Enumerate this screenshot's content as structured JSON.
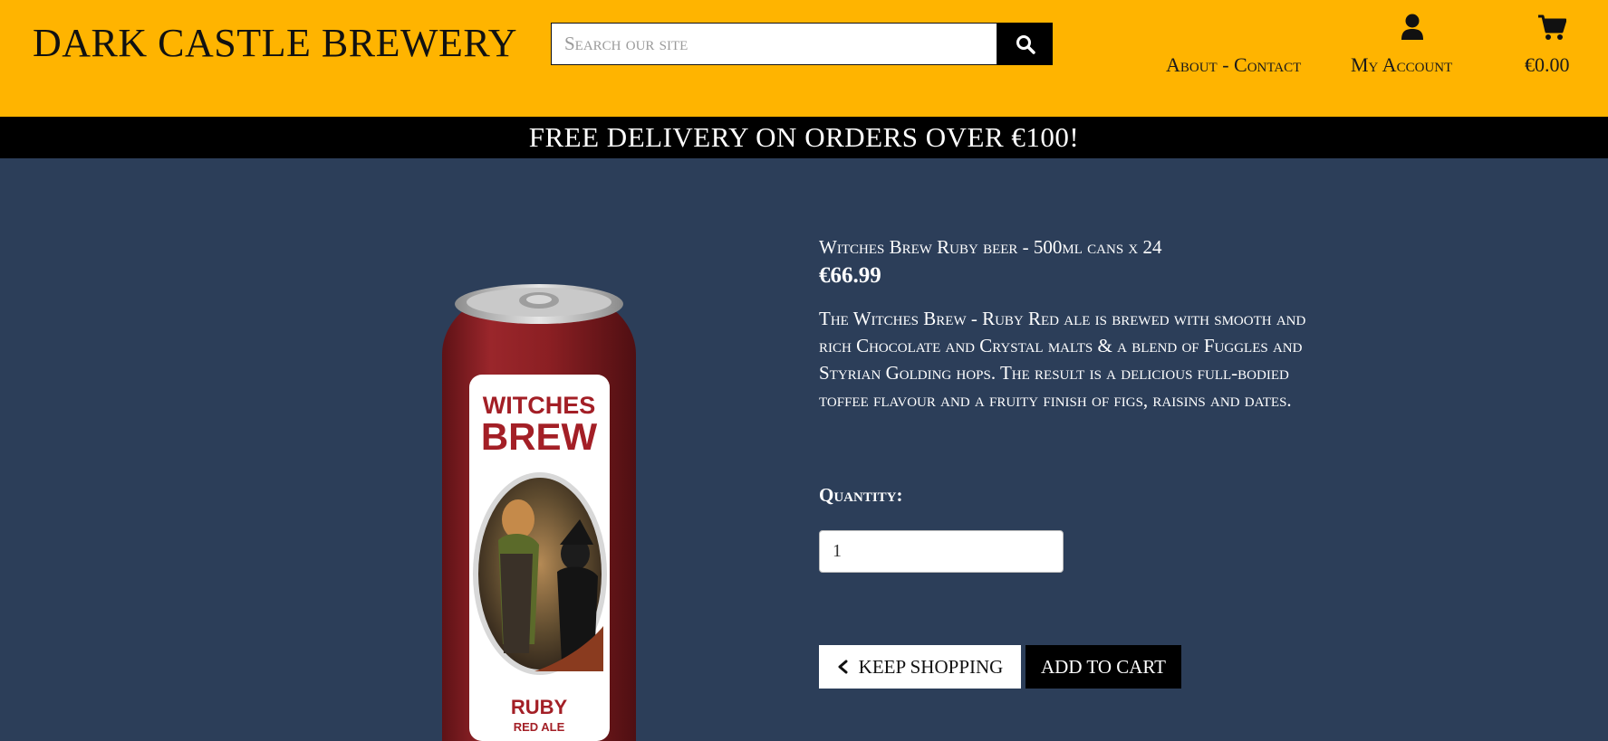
{
  "header": {
    "brand": "Dark Castle Brewery",
    "search": {
      "placeholder": "Search our site",
      "button_icon": "search-icon"
    },
    "nav": {
      "about_contact": "About - Contact",
      "my_account": "My Account",
      "my_account_icon": "user-icon",
      "cart_total": "€0.00",
      "cart_icon": "shopping-cart-icon"
    }
  },
  "banner": {
    "text": "Free delivery on orders over €100!"
  },
  "product": {
    "name": "Witches Brew Ruby beer - 500ml cans x 24",
    "price": "€66.99",
    "description": "The Witches Brew - Ruby Red ale is brewed with smooth and rich Chocolate and Crystal malts & a blend of Fuggles and Styrian Golding hops. The result is a delicious full-bodied toffee flavour and a fruity finish of figs, raisins and dates.",
    "image": {
      "label_line1": "WITCHES",
      "label_line2": "BREW",
      "label_line3": "RUBY",
      "label_line4": "RED ALE"
    },
    "quantity_label": "Quantity:",
    "quantity_value": "1",
    "keep_shopping": "Keep Shopping",
    "add_to_cart": "Add to Cart"
  },
  "colors": {
    "header": "#ffb400",
    "page": "#2c3e59",
    "banner": "#000000",
    "can_red": "#8b1f23"
  }
}
